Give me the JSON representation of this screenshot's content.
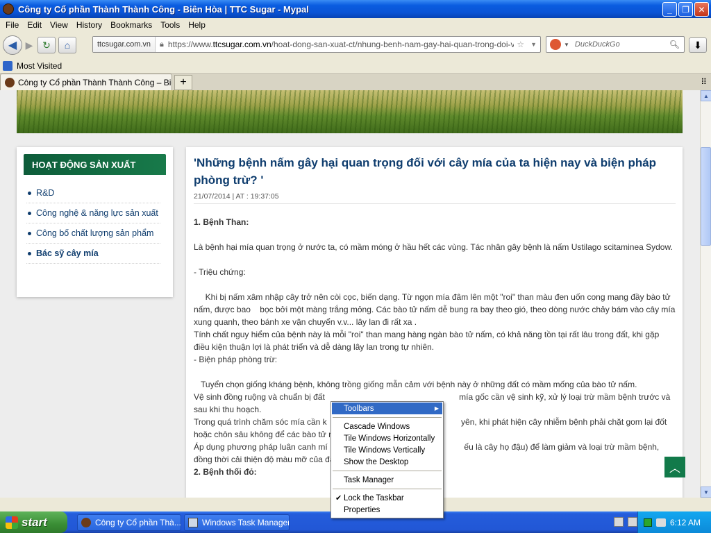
{
  "window": {
    "title": "Công ty Cổ phần Thành Thành Công - Biên Hòa  |  TTC Sugar - Mypal",
    "buttons": [
      "_",
      "❐",
      "✕"
    ]
  },
  "menu": [
    "File",
    "Edit",
    "View",
    "History",
    "Bookmarks",
    "Tools",
    "Help"
  ],
  "nav": {
    "site_identity": "ttcsugar.com.vn",
    "url_prefix": "https://www.",
    "url_host": "ttcsugar.com.vn",
    "url_path": "/hoat-dong-san-xuat-ct/nhung-benh-nam-gay-hai-quan-trong-doi-vc",
    "search_placeholder": "DuckDuckGo"
  },
  "bookmarks": [
    "Most Visited"
  ],
  "tabs": [
    {
      "label": "Công ty Cổ phần Thành Thành Công – Biên ..."
    }
  ],
  "sidebar": {
    "heading": "HOẠT ĐỘNG SẢN XUẤT",
    "items": [
      {
        "label": "R&D"
      },
      {
        "label": "Công nghệ & năng lực sản xuất"
      },
      {
        "label": "Công bố chất lượng sản phẩm"
      },
      {
        "label": "Bác sỹ cây mía"
      }
    ]
  },
  "article": {
    "title": "'Những bệnh nấm gây hại quan trọng đối với cây mía của ta hiện nay và biện pháp phòng trừ? '",
    "date": "21/07/2014 | AT : 19:37:05",
    "section1": "1. Bệnh Than:",
    "p1": "Là bệnh hại mía quan trọng ở nước ta, có mầm móng ở hầu hết các vùng. Tác nhân gây bệnh là nấm Ustilago scitaminea Sydow.",
    "symptoms": "- Triệu chứng:",
    "p2": "     Khi bị nấm xâm nhập cây trở nên còi cọc, biến dạng. Từ ngọn mía đâm lên một \"roi\" than màu đen uốn cong mang đầy bào tử nấm, được bao    bọc bởi một màng trắng mỏng. Các bào tử nấm dễ bung ra bay theo gió, theo dòng nước chảy bám vào cây mía xung quanh, theo bánh xe vận chuyển v.v... lây lan đi rất xa .",
    "p3": "Tính chất nguy hiểm của bệnh này là mỗi \"roi\" than mang hàng ngàn bào tử nấm, có khả năng tồn tại rất lâu trong đất, khi gặp điều kiện thuận lợi là phát triển và dễ dàng lây lan trong tự nhiên.",
    "measures": "- Biện pháp phòng trừ:",
    "p4": "   Tuyển chọn giống kháng bệnh, không trồng giống mẫn cảm với bệnh này ở những đất có mầm mống của bào tử nấm.",
    "p5": "Vệ sinh đồng ruộng và chuẩn bị đất                                                          mía gốc cần vệ sinh kỹ, xử lý loại trừ mầm bệnh trước và sau khi thu hoạch.",
    "p6": "Trong quá trình chăm sóc mía cần k                                                          yên, khi phát hiện cây nhiễm bệnh phải chặt gom lại đốt hoặc chôn sâu không để các bào tử nấm",
    "p7": "Áp dụng phương pháp luân canh mí                                                           ếu là cây họ đậu) để làm giảm và loại trừ mầm bệnh, đồng thời cải thiện độ màu mỡ của đất.",
    "section2": "2. Bệnh thối đỏ:"
  },
  "context_menu": {
    "items": [
      "Toolbars",
      "Cascade Windows",
      "Tile Windows Horizontally",
      "Tile Windows Vertically",
      "Show the Desktop",
      "Task Manager",
      "Lock the Taskbar",
      "Properties"
    ],
    "highlighted": "Toolbars",
    "checked": "Lock the Taskbar"
  },
  "taskbar": {
    "start": "start",
    "tasks": [
      {
        "label": "Công ty Cổ phần Thà..."
      },
      {
        "label": "Windows Task Manager"
      }
    ],
    "clock": "6:12 AM"
  }
}
